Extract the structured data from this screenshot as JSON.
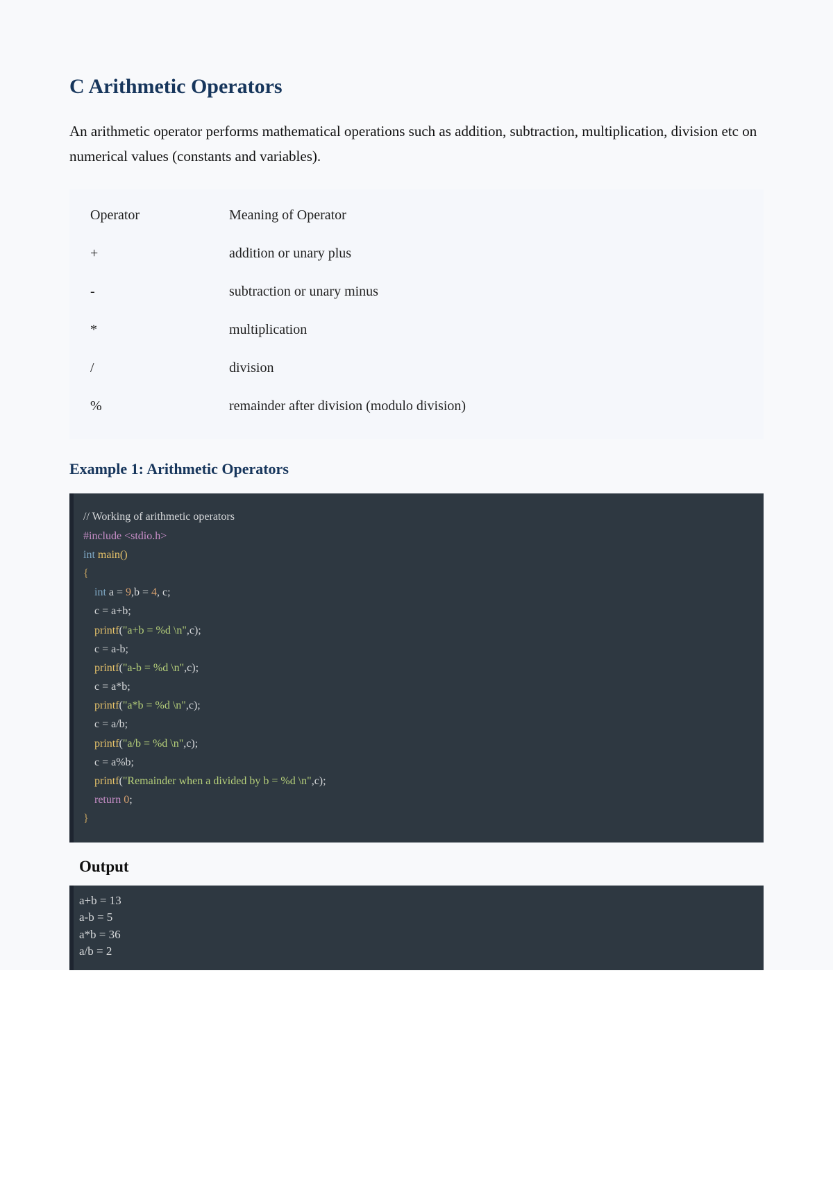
{
  "heading": "C Arithmetic Operators",
  "intro": "An arithmetic operator performs mathematical operations such as addition, subtraction, multiplication, division etc on numerical values (constants and variables).",
  "table": {
    "header": {
      "col1": "Operator",
      "col2": "Meaning of Operator"
    },
    "rows": [
      {
        "op": "+",
        "meaning": "addition or unary plus"
      },
      {
        "op": "-",
        "meaning": "subtraction or unary minus"
      },
      {
        "op": "*",
        "meaning": "multiplication"
      },
      {
        "op": "/",
        "meaning": "division"
      },
      {
        "op": "%",
        "meaning": "remainder after division (modulo division)"
      }
    ]
  },
  "example_title": "Example 1: Arithmetic Operators",
  "code": {
    "l0": "// Working of arithmetic operators",
    "l1a": "#include ",
    "l1b": "<stdio.h>",
    "l2a": "int",
    "l2b": " main()",
    "l3": "{",
    "l4a": "    int",
    "l4b": " a = ",
    "l4c": "9",
    "l4d": ",b = ",
    "l4e": "4",
    "l4f": ", c;",
    "l5": "",
    "l6": "    c = a+b;",
    "l7a": "    printf",
    "l7b": "(",
    "l7c": "\"a+b = %d \\n\"",
    "l7d": ",c);",
    "l8": "    c = a-b;",
    "l9a": "    printf",
    "l9b": "(",
    "l9c": "\"a-b = %d \\n\"",
    "l9d": ",c);",
    "l10": "    c = a*b;",
    "l11a": "    printf",
    "l11b": "(",
    "l11c": "\"a*b = %d \\n\"",
    "l11d": ",c);",
    "l12": "    c = a/b;",
    "l13a": "    printf",
    "l13b": "(",
    "l13c": "\"a/b = %d \\n\"",
    "l13d": ",c);",
    "l14": "    c = a%b;",
    "l15a": "    printf",
    "l15b": "(",
    "l15c": "\"Remainder when a divided by b = %d \\n\"",
    "l15d": ",c);",
    "l16": "",
    "l17a": "    return ",
    "l17b": "0",
    "l17c": ";",
    "l18": "}"
  },
  "output_title": "Output",
  "output": {
    "l0": "a+b = 13",
    "l1": "a-b = 5",
    "l2": "a*b = 36",
    "l3": "a/b = 2"
  }
}
